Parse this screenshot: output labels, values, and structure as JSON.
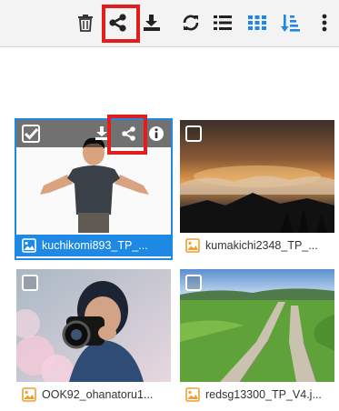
{
  "toolbar": {
    "icons": [
      "trash-icon",
      "share-icon",
      "download-icon",
      "refresh-icon",
      "list-view-icon",
      "grid-view-icon",
      "sort-icon",
      "more-icon"
    ],
    "accent_color": "#1e88e5",
    "highlight_color": "#e31c1c"
  },
  "files": [
    {
      "name": "kuchikomi893_TP_...",
      "selected": true
    },
    {
      "name": "kumakichi2348_TP_...",
      "selected": false
    },
    {
      "name": "OOK92_ohanatoru1...",
      "selected": false
    },
    {
      "name": "redsg13300_TP_V4.j...",
      "selected": false
    }
  ]
}
